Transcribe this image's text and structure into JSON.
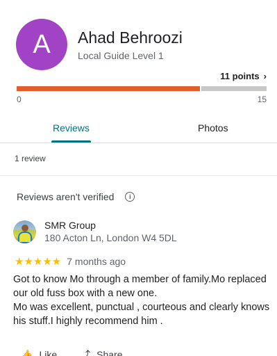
{
  "profile": {
    "initial": "A",
    "name": "Ahad Behroozi",
    "level": "Local Guide Level 1",
    "avatar_color": "#a242c5"
  },
  "points": {
    "label": "11 points",
    "chevron": "›",
    "current": 11,
    "scale_min": "0",
    "scale_max": "15",
    "bar_color": "#e35d2b"
  },
  "tabs": [
    {
      "label": "Reviews",
      "active": true
    },
    {
      "label": "Photos",
      "active": false
    }
  ],
  "review_count": "1 review",
  "verification_note": "Reviews aren't verified",
  "info_icon": "i",
  "review": {
    "reviewer_name": "SMR Group",
    "reviewer_address": "180 Acton Ln, London W4 5DL",
    "rating": 5,
    "stars": "★★★★★",
    "time": "7 months ago",
    "lines": [
      "Got to know Mo through a member of family.Mo replaced our old fuss box with a new one.",
      "Mo was excellent, punctual , courteous and clearly knows his stuff.I highly recommend him ."
    ]
  },
  "actions": {
    "like_label": "Like",
    "like_icon": "👍",
    "share_label": "Share",
    "share_icon": "⤴"
  }
}
